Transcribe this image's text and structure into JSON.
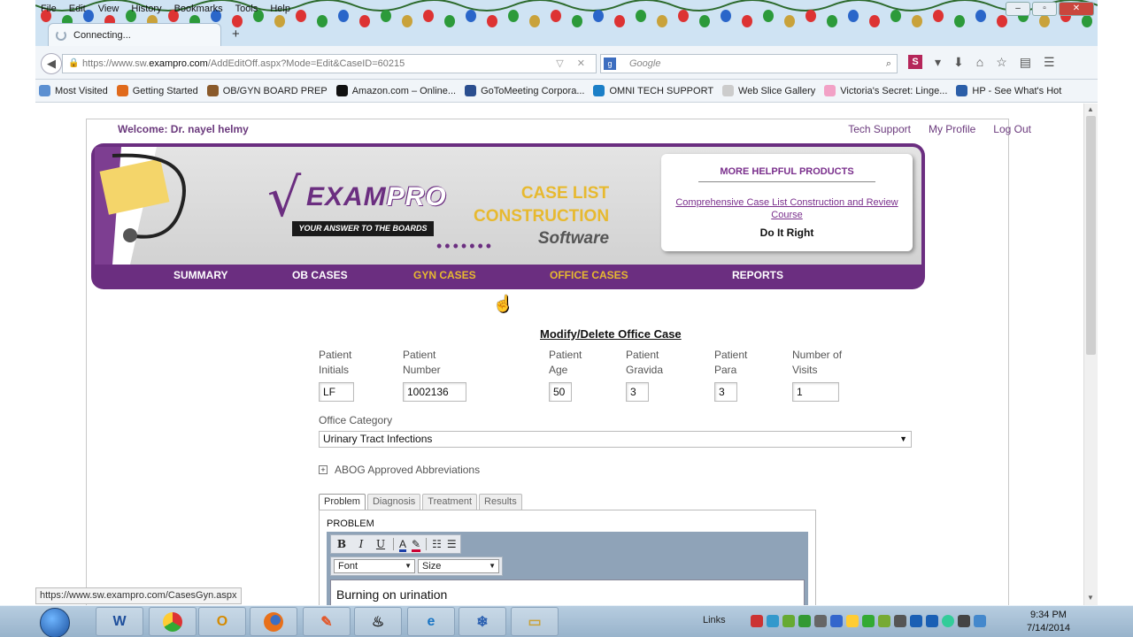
{
  "browser": {
    "menu": [
      "File",
      "Edit",
      "View",
      "History",
      "Bookmarks",
      "Tools",
      "Help"
    ],
    "tab_title": "Connecting...",
    "url_prefix": "https://www.sw.",
    "url_host": "exampro.com",
    "url_path": "/AddEditOff.aspx?Mode=Edit&CaseID=60215",
    "search_placeholder": "Google",
    "bookmarks": [
      {
        "label": "Most Visited",
        "color": "#5b8fd1"
      },
      {
        "label": "Getting Started",
        "color": "#e06a1c"
      },
      {
        "label": "OB/GYN BOARD PREP",
        "color": "#8a5a2b"
      },
      {
        "label": "Amazon.com – Online...",
        "color": "#111111"
      },
      {
        "label": "GoToMeeting Corpora...",
        "color": "#2b4e8f"
      },
      {
        "label": "OMNI TECH SUPPORT",
        "color": "#1b7fc7"
      },
      {
        "label": "Web Slice Gallery",
        "color": "#cccccc"
      },
      {
        "label": "Victoria's Secret: Linge...",
        "color": "#f2a1c6"
      },
      {
        "label": "HP - See What's Hot",
        "color": "#2b5ea8"
      }
    ],
    "status_url": "https://www.sw.exampro.com/CasesGyn.aspx"
  },
  "page": {
    "welcome": "Welcome: Dr. nayel helmy",
    "top_links": [
      "Tech Support",
      "My Profile",
      "Log Out"
    ],
    "logo": {
      "brand": "EXAM",
      "brand_pro": "PRO",
      "tagline": "YOUR ANSWER TO THE BOARDS"
    },
    "product": {
      "line1": "CASE LIST",
      "line2": "CONSTRUCTION",
      "line3": "Software"
    },
    "help_box": {
      "heading": "MORE HELPFUL PRODUCTS",
      "link": "Comprehensive Case List Construction and Review Course",
      "slogan": "Do It Right"
    },
    "nav": [
      "SUMMARY",
      "OB CASES",
      "GYN CASES",
      "OFFICE CASES",
      "REPORTS"
    ],
    "nav_highlight": "GYN CASES",
    "nav_active": "OFFICE CASES",
    "form": {
      "title": "Modify/Delete Office Case",
      "fields": [
        {
          "label1": "Patient",
          "label2": "Initials",
          "value": "LF"
        },
        {
          "label1": "Patient",
          "label2": "Number",
          "value": "1002136"
        },
        {
          "label1": "Patient",
          "label2": "Age",
          "value": "50"
        },
        {
          "label1": "Patient",
          "label2": "Gravida",
          "value": "3"
        },
        {
          "label1": "Patient",
          "label2": "Para",
          "value": "3"
        },
        {
          "label1": "Number of",
          "label2": "Visits",
          "value": "1"
        }
      ],
      "category_label": "Office Category",
      "category_value": "Urinary Tract Infections",
      "abbrev_label": "ABOG Approved Abbreviations",
      "tabs": [
        "Problem",
        "Diagnosis",
        "Treatment",
        "Results"
      ],
      "active_tab": "Problem",
      "problem_label": "PROBLEM",
      "font_dropdown": "Font",
      "size_dropdown": "Size",
      "problem_text": "Burning on urination"
    }
  },
  "taskbar": {
    "tray_label": "Links",
    "time": "9:34 PM",
    "date": "7/14/2014"
  },
  "colors": {
    "brand_purple": "#6b2e80",
    "brand_gold": "#e7b92f"
  }
}
